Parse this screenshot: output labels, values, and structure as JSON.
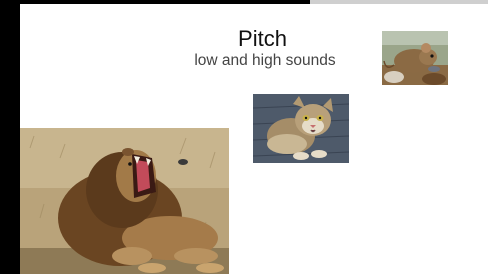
{
  "slide": {
    "title": "Pitch",
    "subtitle": "low and high sounds"
  },
  "images": {
    "mouse": "mouse-photo",
    "cat": "cat-photo",
    "lion": "lion-photo"
  }
}
